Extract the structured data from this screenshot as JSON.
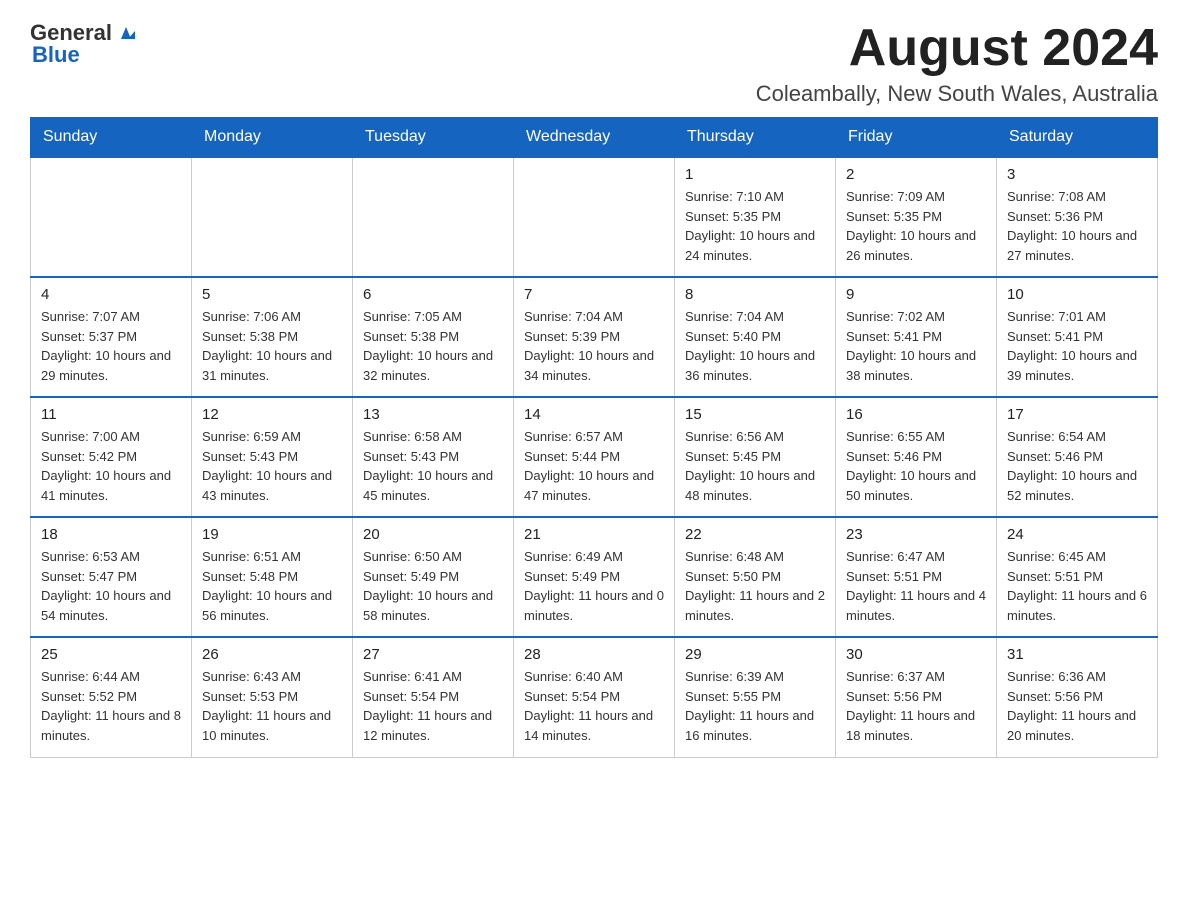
{
  "header": {
    "logo_general": "General",
    "logo_blue": "Blue",
    "month_title": "August 2024",
    "location": "Coleambally, New South Wales, Australia"
  },
  "weekdays": [
    "Sunday",
    "Monday",
    "Tuesday",
    "Wednesday",
    "Thursday",
    "Friday",
    "Saturday"
  ],
  "weeks": [
    [
      {
        "day": "",
        "info": ""
      },
      {
        "day": "",
        "info": ""
      },
      {
        "day": "",
        "info": ""
      },
      {
        "day": "",
        "info": ""
      },
      {
        "day": "1",
        "info": "Sunrise: 7:10 AM\nSunset: 5:35 PM\nDaylight: 10 hours and 24 minutes."
      },
      {
        "day": "2",
        "info": "Sunrise: 7:09 AM\nSunset: 5:35 PM\nDaylight: 10 hours and 26 minutes."
      },
      {
        "day": "3",
        "info": "Sunrise: 7:08 AM\nSunset: 5:36 PM\nDaylight: 10 hours and 27 minutes."
      }
    ],
    [
      {
        "day": "4",
        "info": "Sunrise: 7:07 AM\nSunset: 5:37 PM\nDaylight: 10 hours and 29 minutes."
      },
      {
        "day": "5",
        "info": "Sunrise: 7:06 AM\nSunset: 5:38 PM\nDaylight: 10 hours and 31 minutes."
      },
      {
        "day": "6",
        "info": "Sunrise: 7:05 AM\nSunset: 5:38 PM\nDaylight: 10 hours and 32 minutes."
      },
      {
        "day": "7",
        "info": "Sunrise: 7:04 AM\nSunset: 5:39 PM\nDaylight: 10 hours and 34 minutes."
      },
      {
        "day": "8",
        "info": "Sunrise: 7:04 AM\nSunset: 5:40 PM\nDaylight: 10 hours and 36 minutes."
      },
      {
        "day": "9",
        "info": "Sunrise: 7:02 AM\nSunset: 5:41 PM\nDaylight: 10 hours and 38 minutes."
      },
      {
        "day": "10",
        "info": "Sunrise: 7:01 AM\nSunset: 5:41 PM\nDaylight: 10 hours and 39 minutes."
      }
    ],
    [
      {
        "day": "11",
        "info": "Sunrise: 7:00 AM\nSunset: 5:42 PM\nDaylight: 10 hours and 41 minutes."
      },
      {
        "day": "12",
        "info": "Sunrise: 6:59 AM\nSunset: 5:43 PM\nDaylight: 10 hours and 43 minutes."
      },
      {
        "day": "13",
        "info": "Sunrise: 6:58 AM\nSunset: 5:43 PM\nDaylight: 10 hours and 45 minutes."
      },
      {
        "day": "14",
        "info": "Sunrise: 6:57 AM\nSunset: 5:44 PM\nDaylight: 10 hours and 47 minutes."
      },
      {
        "day": "15",
        "info": "Sunrise: 6:56 AM\nSunset: 5:45 PM\nDaylight: 10 hours and 48 minutes."
      },
      {
        "day": "16",
        "info": "Sunrise: 6:55 AM\nSunset: 5:46 PM\nDaylight: 10 hours and 50 minutes."
      },
      {
        "day": "17",
        "info": "Sunrise: 6:54 AM\nSunset: 5:46 PM\nDaylight: 10 hours and 52 minutes."
      }
    ],
    [
      {
        "day": "18",
        "info": "Sunrise: 6:53 AM\nSunset: 5:47 PM\nDaylight: 10 hours and 54 minutes."
      },
      {
        "day": "19",
        "info": "Sunrise: 6:51 AM\nSunset: 5:48 PM\nDaylight: 10 hours and 56 minutes."
      },
      {
        "day": "20",
        "info": "Sunrise: 6:50 AM\nSunset: 5:49 PM\nDaylight: 10 hours and 58 minutes."
      },
      {
        "day": "21",
        "info": "Sunrise: 6:49 AM\nSunset: 5:49 PM\nDaylight: 11 hours and 0 minutes."
      },
      {
        "day": "22",
        "info": "Sunrise: 6:48 AM\nSunset: 5:50 PM\nDaylight: 11 hours and 2 minutes."
      },
      {
        "day": "23",
        "info": "Sunrise: 6:47 AM\nSunset: 5:51 PM\nDaylight: 11 hours and 4 minutes."
      },
      {
        "day": "24",
        "info": "Sunrise: 6:45 AM\nSunset: 5:51 PM\nDaylight: 11 hours and 6 minutes."
      }
    ],
    [
      {
        "day": "25",
        "info": "Sunrise: 6:44 AM\nSunset: 5:52 PM\nDaylight: 11 hours and 8 minutes."
      },
      {
        "day": "26",
        "info": "Sunrise: 6:43 AM\nSunset: 5:53 PM\nDaylight: 11 hours and 10 minutes."
      },
      {
        "day": "27",
        "info": "Sunrise: 6:41 AM\nSunset: 5:54 PM\nDaylight: 11 hours and 12 minutes."
      },
      {
        "day": "28",
        "info": "Sunrise: 6:40 AM\nSunset: 5:54 PM\nDaylight: 11 hours and 14 minutes."
      },
      {
        "day": "29",
        "info": "Sunrise: 6:39 AM\nSunset: 5:55 PM\nDaylight: 11 hours and 16 minutes."
      },
      {
        "day": "30",
        "info": "Sunrise: 6:37 AM\nSunset: 5:56 PM\nDaylight: 11 hours and 18 minutes."
      },
      {
        "day": "31",
        "info": "Sunrise: 6:36 AM\nSunset: 5:56 PM\nDaylight: 11 hours and 20 minutes."
      }
    ]
  ]
}
